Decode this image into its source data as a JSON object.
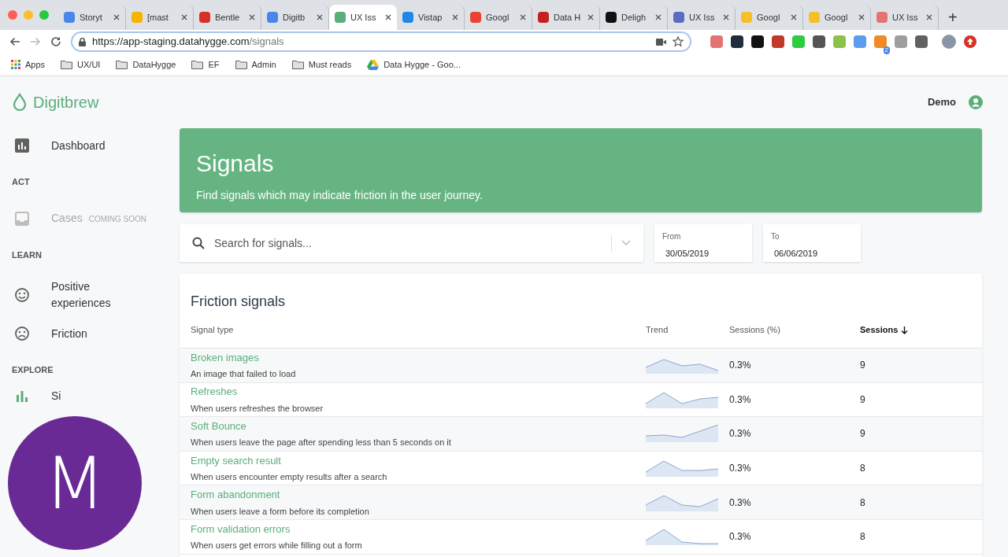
{
  "browser": {
    "tabs": [
      {
        "title": "Storyt",
        "color": "#4a86e8",
        "selected": false
      },
      {
        "title": "[mast",
        "color": "#f4b400",
        "selected": false
      },
      {
        "title": "Bentle",
        "color": "#d93025",
        "selected": false
      },
      {
        "title": "Digitb",
        "color": "#4a86e8",
        "selected": false
      },
      {
        "title": "UX Iss",
        "color": "#5aae7a",
        "selected": true
      },
      {
        "title": "Vistap",
        "color": "#1e88e5",
        "selected": false
      },
      {
        "title": "Googl",
        "color": "#ea4335",
        "selected": false
      },
      {
        "title": "Data H",
        "color": "#c5221f",
        "selected": false
      },
      {
        "title": "Deligh",
        "color": "#111111",
        "selected": false
      },
      {
        "title": "UX Iss",
        "color": "#5c6bc0",
        "selected": false
      },
      {
        "title": "Googl",
        "color": "#f6bf26",
        "selected": false
      },
      {
        "title": "Googl",
        "color": "#f6bf26",
        "selected": false
      },
      {
        "title": "UX Iss",
        "color": "#e57373",
        "selected": false
      }
    ],
    "new_tab": "+",
    "url_host": "https://app-staging.datahygge.com",
    "url_path": "/signals",
    "extensions": [
      {
        "color": "#e57373"
      },
      {
        "color": "#1f2d3d"
      },
      {
        "color": "#111111"
      },
      {
        "color": "#c0392b"
      },
      {
        "color": "#2ecc40"
      },
      {
        "color": "#555555"
      },
      {
        "color": "#8bc34a"
      },
      {
        "color": "#5c9ded"
      },
      {
        "color": "#f08a24",
        "badge": "2"
      },
      {
        "color": "#9e9e9e"
      },
      {
        "color": "#616161"
      }
    ],
    "bookmarks": [
      {
        "kind": "apps",
        "label": "Apps"
      },
      {
        "kind": "folder",
        "label": "UX/UI"
      },
      {
        "kind": "folder",
        "label": "DataHygge"
      },
      {
        "kind": "folder",
        "label": "EF"
      },
      {
        "kind": "folder",
        "label": "Admin"
      },
      {
        "kind": "folder",
        "label": "Must reads"
      },
      {
        "kind": "drive",
        "label": "Data Hygge - Goo..."
      }
    ]
  },
  "app": {
    "logo": "Digitbrew",
    "user": "Demo",
    "sidebar": [
      {
        "kind": "item",
        "label": "Dashboard",
        "disabled": false
      },
      {
        "kind": "section",
        "label": "ACT"
      },
      {
        "kind": "item",
        "label": "Cases",
        "badge": "COMING SOON",
        "disabled": true
      },
      {
        "kind": "section",
        "label": "LEARN"
      },
      {
        "kind": "item",
        "label": "Positive experiences",
        "disabled": false
      },
      {
        "kind": "item",
        "label": "Friction",
        "disabled": false
      },
      {
        "kind": "section",
        "label": "EXPLORE"
      },
      {
        "kind": "item",
        "label": "Si",
        "disabled": false
      }
    ],
    "banner": {
      "title": "Signals",
      "subtitle": "Find signals which may indicate friction in the user journey."
    },
    "search": {
      "placeholder": "Search for signals..."
    },
    "from": {
      "label": "From",
      "value": "30/05/2019"
    },
    "to": {
      "label": "To",
      "value": "06/06/2019"
    },
    "table": {
      "title": "Friction signals",
      "columns": [
        "Signal type",
        "Trend",
        "Sessions (%)",
        "Sessions"
      ],
      "rows": [
        {
          "name": "Broken images",
          "description": "An image that failed to load",
          "percent": "0.3%",
          "sessions": "9"
        },
        {
          "name": "Refreshes",
          "description": "When users refreshes the browser",
          "percent": "0.3%",
          "sessions": "9"
        },
        {
          "name": "Soft Bounce",
          "description": "When users leave the page after spending less than 5 seconds on it",
          "percent": "0.3%",
          "sessions": "9"
        },
        {
          "name": "Empty search result",
          "description": "When users encounter empty results after a search",
          "percent": "0.3%",
          "sessions": "8"
        },
        {
          "name": "Form abandonment",
          "description": "When users leave a form before its completion",
          "percent": "0.3%",
          "sessions": "8"
        },
        {
          "name": "Form validation errors",
          "description": "When users get errors while filling out a form",
          "percent": "0.3%",
          "sessions": "8"
        }
      ]
    }
  },
  "call_overlay": {
    "initial": "M"
  }
}
